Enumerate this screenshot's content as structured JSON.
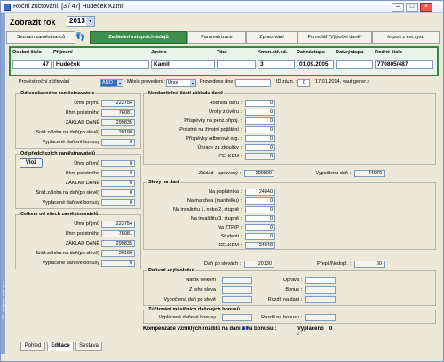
{
  "window": {
    "title": "Roční zúčtování: [3 / 47] Hudeček Kamil",
    "btn_minimize": "–",
    "btn_maximize": "□",
    "btn_close": "×"
  },
  "sidebar_vertical_text": "KS - program, spol. s r.o.",
  "year": {
    "label": "Zobrazit rok",
    "value": "2013",
    "dropdown": "▾"
  },
  "tabs": [
    "Seznam zaměstnanců",
    "Zadávání vstupních údajů",
    "Parametrizace",
    "Zpracování",
    "Formulář \"Výpočet daně\"",
    "Import z ext.syst."
  ],
  "tab_icon": "👣",
  "employee": {
    "headers": [
      "Osobní číslo",
      "Příjmení",
      "Jméno",
      "Titul",
      "Kmen.stř.ed.",
      "Dat.nástupu",
      "Dat.výstupu",
      "Rodné číslo"
    ],
    "values": [
      "47",
      "Hudeček",
      "Kamil",
      "",
      "3",
      "01.09.2005",
      "",
      "770805/487"
    ]
  },
  "row2": {
    "provest_label": "Provést roční zúčtování",
    "provest_value": "ANO",
    "mesic_label": "Měsíc provedení :",
    "mesic_value": "Únor",
    "provedeno_label": "Provedeno dne :",
    "provedeno_value": "",
    "id_label": "ID zázn. :",
    "id_value": "0",
    "gen_text": "17.01.2014, <aut.gener.>"
  },
  "soucasny": {
    "title": "Od současného zaměstnavatele",
    "rows": [
      {
        "label": "Úhrn příjmů",
        "value": "223754"
      },
      {
        "label": "Úhrn pojistného",
        "value": "76081"
      },
      {
        "label": "ZÁKLAD DANĚ",
        "value": "299835"
      },
      {
        "label": "Sráž.záloha na daň(po slevě)",
        "value": "20190"
      },
      {
        "label": "Vyplacené daňové bonusy",
        "value": "0"
      }
    ]
  },
  "predchozi": {
    "title": "Od předchozích zaměstnavatelů",
    "vloz_label": "Vlož",
    "rows": [
      {
        "label": "Úhrn příjmů",
        "value": "0"
      },
      {
        "label": "Úhrn pojistného",
        "value": "0"
      },
      {
        "label": "ZÁKLAD DANĚ",
        "value": "0"
      },
      {
        "label": "Sráž.záloha na daň(po slevě)",
        "value": "0"
      },
      {
        "label": "Vyplacené daňové bonusy",
        "value": "0"
      }
    ]
  },
  "celkem": {
    "title": "Celkem od všech zaměstnavatelů",
    "rows": [
      {
        "label": "Úhrn příjmů",
        "value": "223754"
      },
      {
        "label": "Úhrn pojistného",
        "value": "76081"
      },
      {
        "label": "ZÁKLAD DANĚ",
        "value": "299835"
      },
      {
        "label": "Sráž.záloha na daň(po slevě)",
        "value": "20190"
      },
      {
        "label": "Vyplacené daňové bonusy",
        "value": "0"
      }
    ]
  },
  "nezdanitelne": {
    "title": "Nezdanitelné části základu daně",
    "rows": [
      {
        "label": "Hodnota daru :",
        "value": "0"
      },
      {
        "label": "Úroky z úvěru :",
        "value": "0"
      },
      {
        "label": "Příspěvky na penz.připoj. :",
        "value": "0"
      },
      {
        "label": "Pojistné na životní pojištění :",
        "value": "0"
      },
      {
        "label": "Příspěvky odborové org. :",
        "value": "0"
      },
      {
        "label": "Úhrady za zkoušky :",
        "value": "0"
      },
      {
        "label": "CELKEM :",
        "value": "0"
      }
    ],
    "zaklad_label": "Základ - upravený :",
    "zaklad_value": "299800",
    "vypoctena_label": "Vypočtená daň :",
    "vypoctena_value": "44970"
  },
  "slevy": {
    "title": "Slevy na dani",
    "rows": [
      {
        "label": "Na poplatníka :",
        "value": "24840"
      },
      {
        "label": "Na manžela (manželku) :",
        "value": "0"
      },
      {
        "label": "Na invaliditu 1. nebo 2. stupně :",
        "value": "0"
      },
      {
        "label": "Na invaliditu 3. stupně :",
        "value": "0"
      },
      {
        "label": "Na ZTP/P :",
        "value": "0"
      },
      {
        "label": "Studenti :",
        "value": "0"
      },
      {
        "label": "CELKEM :",
        "value": "24840"
      }
    ],
    "dan_po_slevach_label": "Daň po slevách :",
    "dan_po_slevach_value": "20130",
    "preplnedopl_label": "Přepl./Nedopl. :",
    "preplnedopl_value": "60"
  },
  "zvyhodneni": {
    "title": "Daňové zvýhodnění",
    "narok_label": "Nárok celkem :",
    "narok_value": "",
    "z_toho_label": "Z toho sleva :",
    "z_toho_value": "",
    "vypoctena_label": "Vypočtená daň po slevě :",
    "vypoctena_value": "",
    "oprava_label": "Oprava :",
    "oprava_value": "",
    "bonus_label": "Bonus :",
    "bonus_value": "",
    "rozdil_label": "Rozdíl na dani :",
    "rozdil_value": ""
  },
  "mesicni": {
    "title": "Zúčtování měsíčních daňových bonusů",
    "vypl_label": "Vyplácené daňové bonusy :",
    "vypl_value": "",
    "rozdil_label": "Rozdíl na bonusu :",
    "rozdil_value": ""
  },
  "bottom": {
    "kompenzace_label": "Kompenzace vzniklých rozdílů na dani a na bonusu :",
    "kompenzace_value": "60",
    "vyplaceno_label": "Vyplaceno :",
    "vyplaceno_value": "0"
  },
  "bottom_tabs": [
    "Pohled",
    "Editace",
    "Sestava"
  ]
}
